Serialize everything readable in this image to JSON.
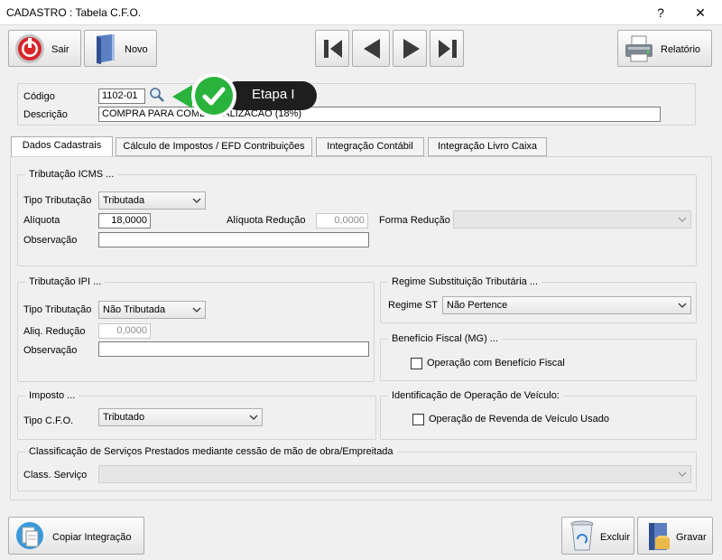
{
  "window": {
    "title": "CADASTRO : Tabela C.F.O.",
    "help": "?",
    "close": "✕"
  },
  "toolbar": {
    "exit_label": "Sair",
    "new_label": "Novo",
    "report_label": "Relatório"
  },
  "header": {
    "codigo_label": "Código",
    "codigo_value": "1102-01",
    "descricao_label": "Descrição",
    "descricao_value": "COMPRA PARA COMERCIALIZACAO (18%)",
    "etapa_label": "Etapa I"
  },
  "tabs": [
    {
      "label": "Dados Cadastrais"
    },
    {
      "label": "Cálculo de Impostos / EFD Contribuições"
    },
    {
      "label": "Integração Contábil"
    },
    {
      "label": "Integração Livro Caixa"
    }
  ],
  "icms": {
    "title": "Tributação ICMS ...",
    "tipo_label": "Tipo Tributação",
    "tipo_value": "Tributada",
    "aliquota_label": "Alíquota",
    "aliquota_value": "18,0000",
    "reducao_label": "Alíquota Redução",
    "reducao_value": "0,0000",
    "forma_label": "Forma Redução",
    "forma_value": "",
    "obs_label": "Observação",
    "obs_value": ""
  },
  "ipi": {
    "title": "Tributação IPI ...",
    "tipo_label": "Tipo Tributação",
    "tipo_value": "Não Tributada",
    "reducao_label": "Aliq. Redução",
    "reducao_value": "0,0000",
    "obs_label": "Observação",
    "obs_value": ""
  },
  "regime": {
    "title": "Regime Substituição Tributária ...",
    "label": "Regime ST",
    "value": "Não Pertence"
  },
  "beneficio": {
    "title": "Benefício Fiscal (MG) ...",
    "check_label": "Operação com Benefício Fiscal",
    "checked": false
  },
  "imposto": {
    "title": "Imposto ...",
    "tipo_label": "Tipo C.F.O.",
    "tipo_value": "Tributado"
  },
  "veiculo": {
    "title": "Identificação de Operação de Veículo:",
    "check_label": "Operação de Revenda de Veículo Usado",
    "checked": false
  },
  "servicos": {
    "title": "Classificação de Serviços Prestados mediante cessão de mão de obra/Empreitada",
    "label": "Class. Serviço",
    "value": ""
  },
  "footer": {
    "copy_label": "Copiar Integração",
    "delete_label": "Excluir",
    "save_label": "Gravar"
  },
  "colors": {
    "accent_green": "#29b33c",
    "badge_dark": "#1e1e1e",
    "exit_red": "#d8262a"
  }
}
